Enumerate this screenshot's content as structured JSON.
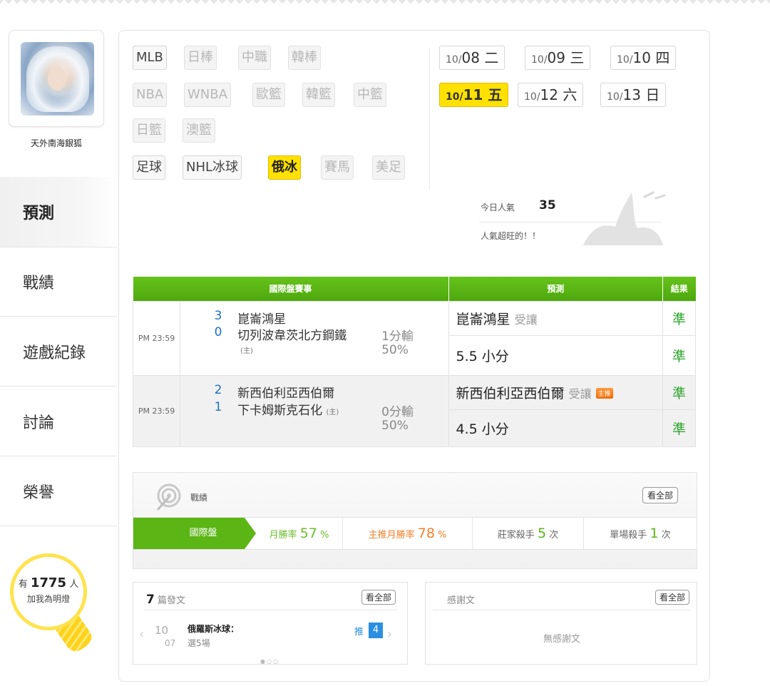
{
  "user": {
    "name": "天外南海銀狐"
  },
  "sidebar": {
    "items": [
      {
        "label": "預測"
      },
      {
        "label": "戰績"
      },
      {
        "label": "遊戲紀錄"
      },
      {
        "label": "討論"
      },
      {
        "label": "榮譽"
      }
    ]
  },
  "fans": {
    "prefix": "有",
    "count": "1775",
    "suffix": "人",
    "line2": "加我為明燈"
  },
  "sports": {
    "row1": [
      "MLB",
      "日棒",
      "中職",
      "韓棒"
    ],
    "row2": [
      "NBA",
      "WNBA",
      "歐籃",
      "韓籃",
      "中籃"
    ],
    "row3": [
      "日籃",
      "澳籃"
    ],
    "row4": [
      "足球",
      "NHL冰球",
      "俄冰",
      "賽馬",
      "美足"
    ],
    "selected": "俄冰"
  },
  "dates": [
    {
      "d": "10/",
      "n": "08",
      "w": "二"
    },
    {
      "d": "10/",
      "n": "09",
      "w": "三"
    },
    {
      "d": "10/",
      "n": "10",
      "w": "四"
    },
    {
      "d": "10/",
      "n": "11",
      "w": "五"
    },
    {
      "d": "10/",
      "n": "12",
      "w": "六"
    },
    {
      "d": "10/",
      "n": "13",
      "w": "日"
    }
  ],
  "popularity": {
    "label": "今日人氣",
    "count": "35",
    "note": "人氣超旺的！！"
  },
  "table": {
    "headers": [
      "國際盤賽事",
      "預測",
      "結果"
    ],
    "games": [
      {
        "time": "PM 23:59",
        "away_score": "3",
        "away": "崑崙鴻星",
        "home_score": "0",
        "home": "切列波韋茨北方鋼鐵",
        "home_tag": "(主)",
        "handicap": "1分輸",
        "pct": "50%",
        "pred1": "崑崙鴻星",
        "pred1_tag": "受讓",
        "pred1_badge": "",
        "res1": "準",
        "pred2": "5.5 小分",
        "res2": "準"
      },
      {
        "time": "PM 23:59",
        "away_score": "2",
        "away": "新西伯利亞西伯爾",
        "home_score": "1",
        "home": "下卡姆斯克石化",
        "home_tag": "(主)",
        "handicap": "0分輸",
        "pct": "50%",
        "pred1": "新西伯利亞西伯爾",
        "pred1_tag": "受讓",
        "pred1_badge": "主推",
        "res1": "準",
        "pred2": "4.5 小分",
        "res2": "準"
      }
    ]
  },
  "record": {
    "title": "戰績",
    "view_all": "看全部",
    "cells": {
      "category": "國際盤",
      "monthly_label": "月勝率",
      "monthly_value": "57",
      "monthly_unit": "%",
      "main_label": "主推月勝率",
      "main_value": "78",
      "main_unit": "%",
      "house_label": "莊家殺手",
      "house_value": "5",
      "house_unit": "次",
      "single_label": "單場殺手",
      "single_value": "1",
      "single_unit": "次"
    }
  },
  "posts": {
    "count": "7",
    "label": "篇發文",
    "view_all": "看全部",
    "item": {
      "month": "10",
      "day": "07",
      "title": "俄羅斯冰球：",
      "sub": "選5場",
      "push_label": "推",
      "push_count": "4"
    }
  },
  "thanks": {
    "label": "感謝文",
    "view_all": "看全部",
    "empty": "無感謝文"
  },
  "colors": {
    "accent": "#5bb515",
    "highlight": "#ffe100",
    "score_blue": "#1f6fc0",
    "orange": "#f2802a"
  }
}
